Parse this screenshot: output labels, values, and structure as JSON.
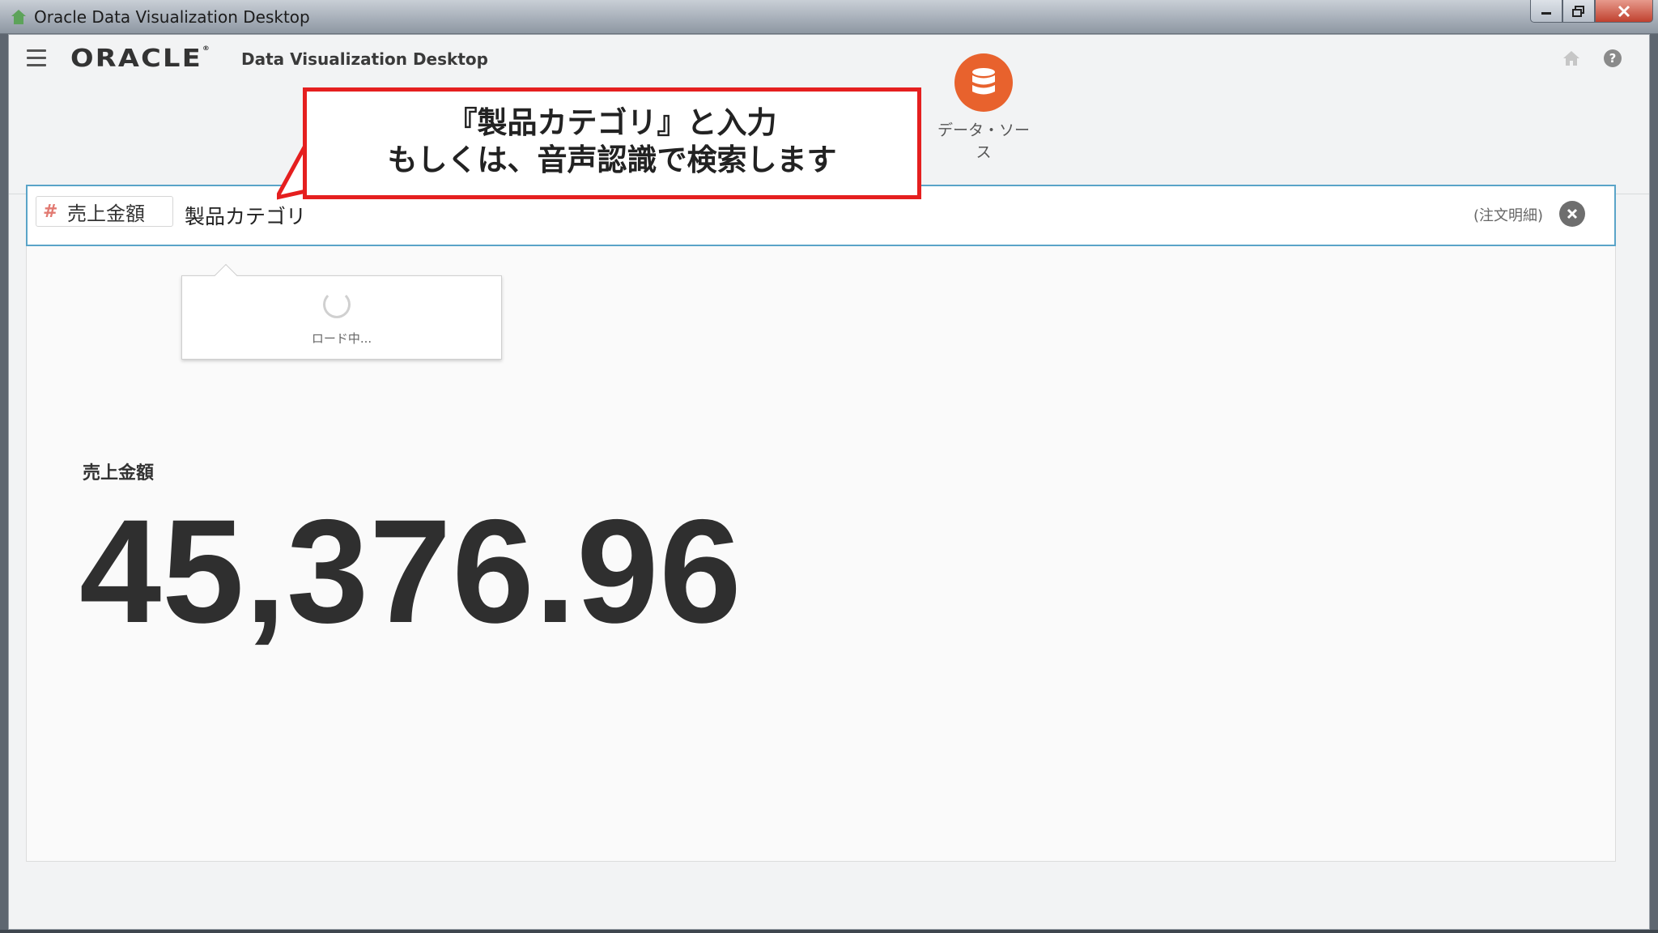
{
  "window": {
    "title": "Oracle Data Visualization Desktop"
  },
  "header": {
    "logo": "ORACLE",
    "product_name": "Data Visualization Desktop"
  },
  "callout": {
    "line1": "『製品カテゴリ』と入力",
    "line2": "もしくは、音声認識で検索します"
  },
  "data_source": {
    "label": "データ・ソース"
  },
  "search": {
    "pill_label": "売上金額",
    "query": "製品カテゴリ",
    "scope": "(注文明細)"
  },
  "loading": {
    "text": "ロード中..."
  },
  "kpi": {
    "label": "売上金額",
    "value": "45,376.96"
  },
  "colors": {
    "accent_orange": "#e8622d",
    "callout_border": "#e51f1f",
    "search_border": "#5aa4c8"
  }
}
